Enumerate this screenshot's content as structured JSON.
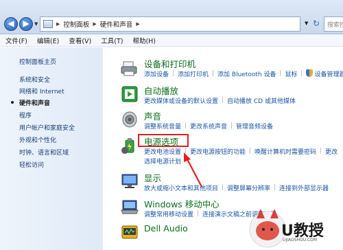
{
  "breadcrumb": [
    "控制面板",
    "硬件和声音"
  ],
  "search_placeholder": "搜索控",
  "menu": [
    "文件(F)",
    "编辑(E)",
    "查看(V)",
    "工具(T)",
    "帮助(H)"
  ],
  "sidebar": {
    "home": "控制面板主页",
    "items": [
      "系统和安全",
      "网络和 Internet",
      "硬件和声音",
      "程序",
      "用户帐户和家庭安全",
      "外观和个性化",
      "时钟、语言和区域",
      "轻松访问"
    ],
    "current_index": 2
  },
  "categories": [
    {
      "title": "设备和打印机",
      "icon": "printer-icon",
      "links": [
        "添加设备",
        "添加打印机",
        "添加 Bluetooth 设备",
        "鼠标",
        "设备管理器"
      ],
      "shield_on": 4
    },
    {
      "title": "自动播放",
      "icon": "autoplay-icon",
      "links": [
        "更改媒体或设备的默认设置",
        "自动播放 CD 或其他媒体"
      ]
    },
    {
      "title": "声音",
      "icon": "speaker-icon",
      "links": [
        "调整系统音量",
        "更改系统声音",
        "管理音频设备"
      ]
    },
    {
      "title": "电源选项",
      "icon": "power-icon",
      "links": [
        "更改电池设置",
        "更改电源按钮的功能",
        "唤醒计算机时需要密码",
        "更改"
      ],
      "links2": [
        "选择电源计划"
      ]
    },
    {
      "title": "显示",
      "icon": "display-icon",
      "links": [
        "放大或缩小文本和其他项目",
        "调整屏幕分辨率",
        "连接到外部显示器"
      ]
    },
    {
      "title": "Windows 移动中心",
      "icon": "mobility-icon",
      "links": [
        "调整常用移动设置",
        "连接演示文稿之前调整设置"
      ]
    },
    {
      "title": "Dell Audio",
      "icon": "dell-audio-icon",
      "links": []
    }
  ],
  "watermark": {
    "text": "U教授",
    "subtext": "UJIAOSHOU.COM"
  },
  "colors": {
    "title_green": "#0b6e18",
    "link_blue": "#1a56a8",
    "highlight_red": "#e02020"
  }
}
